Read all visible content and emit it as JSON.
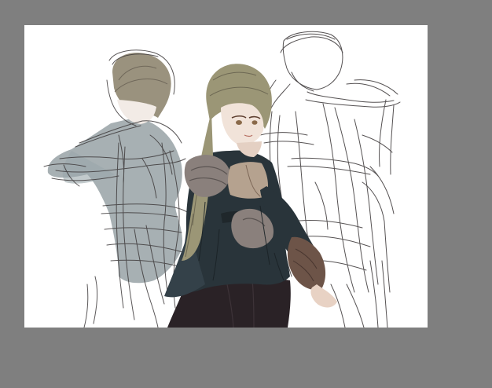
{
  "workspace": {
    "background_color": "#7f7f7f"
  },
  "canvas": {
    "background_color": "#ffffff",
    "content": "illustration-sketch"
  },
  "colors": {
    "sketch_line": "#3e3a3b",
    "left_figure_fill": "#8e9a9e",
    "left_hair": "#9a927e",
    "center_hair": "#9b9676",
    "center_coat": "#29343a",
    "center_pants": "#2a2226",
    "armor": "#8a807c",
    "skin": "#f1e3d9",
    "leather": "#6d5448"
  }
}
